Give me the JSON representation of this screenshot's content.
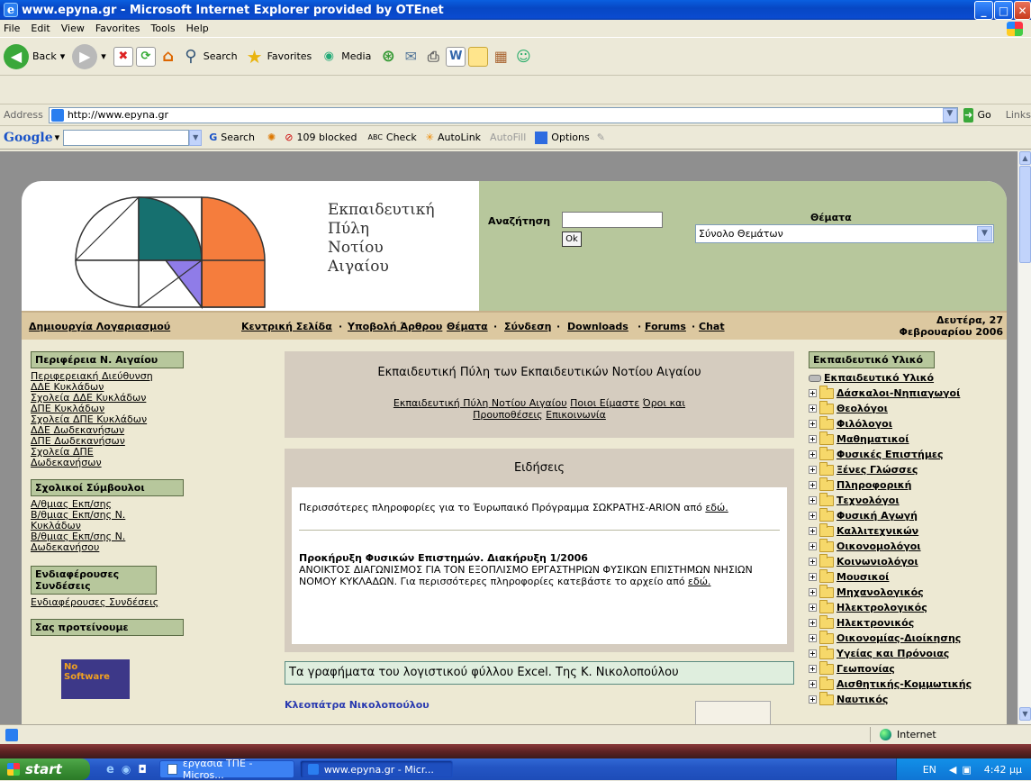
{
  "window": {
    "title": "www.epyna.gr - Microsoft Internet Explorer provided by OTEnet"
  },
  "menu": [
    "File",
    "Edit",
    "View",
    "Favorites",
    "Tools",
    "Help"
  ],
  "toolbar": {
    "back": "Back",
    "search": "Search",
    "favorites": "Favorites",
    "media": "Media"
  },
  "address": {
    "label": "Address",
    "url": "http://www.epyna.gr",
    "go": "Go",
    "links": "Links"
  },
  "google": {
    "logo": "Google",
    "search": "Search",
    "blocked": "109 blocked",
    "check": "Check",
    "autolink": "AutoLink",
    "autofill": "AutoFill",
    "options": "Options"
  },
  "site": {
    "logo_text": [
      "Εκπαιδευτική",
      "Πύλη",
      "Νοτίου",
      "Αιγαίου"
    ],
    "search_label": "Αναζήτηση",
    "search_button": "Ok",
    "themes_label": "Θέματα",
    "themes_selected": "Σύνολο Θεμάτων",
    "nav": {
      "create_account": "Δημιουργία Λογαριασμού",
      "home": "Κεντρική Σελίδα",
      "submit": "Υποβολή Άρθρου",
      "themes": "Θέματα",
      "login": "Σύνδεση",
      "downloads": "Downloads",
      "forums": "Forums",
      "chat": "Chat",
      "date_line1": "Δευτέρα, 27",
      "date_line2": "Φεβρουαρίου 2006"
    },
    "left": {
      "region_title": "Περιφέρεια Ν. Αιγαίου",
      "region_links": [
        "Περιφερειακή Διεύθυνση",
        "ΔΔΕ Κυκλάδων",
        "Σχολεία ΔΔΕ Κυκλάδων",
        "ΔΠΕ Κυκλάδων",
        "Σχολεία ΔΠΕ Κυκλάδων",
        "ΔΔΕ Δωδεκανήσων",
        "ΔΠΕ Δωδεκανήσων",
        "Σχολεία ΔΠΕ",
        "Δωδεκανήσων"
      ],
      "advisors_title": "Σχολικοί Σύμβουλοι",
      "advisors_links": [
        "Α/θμιας Εκπ/σης",
        "Β/θμιας Εκπ/σης Ν.",
        "Κυκλάδων",
        "Β/θμιας Εκπ/σης Ν.",
        "Δωδεκανήσου"
      ],
      "interesting_title": "Ενδιαφέρουσες Συνδέσεις",
      "interesting_link": "Ενδιαφέρουσες Συνδέσεις",
      "suggest_title": "Σας προτείνουμε",
      "banner_text": [
        "No",
        "Software"
      ]
    },
    "center": {
      "portal_title": "Εκπαιδευτική Πύλη των Εκπαιδευτικών Νοτίου Αιγαίου",
      "portal_link1": "Εκπαιδευτική Πύλη Νοτίου Αιγαίου",
      "portal_link2": "Ποιοι Είμαστε",
      "portal_link3": "Όροι και",
      "portal_link3b": "Προυποθέσεις",
      "portal_link4": "Επικοινωνία",
      "news_title": "Ειδήσεις",
      "news1_text": "Περισσότερες πληροφορίες για το Έυρωπαικό Πρόγραμμα ΣΩΚΡΑΤΗΣ-ARION από",
      "news1_link": "εδώ.",
      "news2_title": "Προκήρυξη Φυσικών Επιστημών. Διακήρυξη 1/2006",
      "news2_text": "ΑΝΟΙΚΤΟΣ ΔΙΑΓΩΝΙΣΜΟΣ ΓΙΑ ΤΟΝ ΕΞΟΠΛΙΣΜΟ ΕΡΓΑΣΤΗΡΙΩΝ ΦΥΣΙΚΩΝ ΕΠΙΣΤΗΜΩΝ ΝΗΣΙΩΝ ΝΟΜΟΥ ΚΥΚΛΑΔΩΝ. Για περισσότερες πληροφορίες κατεβάστε το αρχείο από",
      "news2_link": "εδώ.",
      "article_title": "Τα γραφήματα του λογιστικού φύλλου Excel. Της Κ. Νικολοπούλου",
      "author": "Κλεοπάτρα Νικολοπούλου"
    },
    "right": {
      "title": "Εκπαιδευτικό Υλικό",
      "root": "Εκπαιδευτικό Υλικό",
      "items": [
        "Δάσκαλοι-Νηπιαγωγοί",
        "Θεολόγοι",
        "Φιλόλογοι",
        "Μαθηματικοί",
        "Φυσικές Επιστήμες",
        "Ξένες Γλώσσες",
        "Πληροφορική",
        "Τεχνολόγοι",
        "Φυσική Αγωγή",
        "Καλλιτεχνικών",
        "Οικονομολόγοι",
        "Κοινωνιολόγοι",
        "Μουσικοί",
        "Μηχανολογικός",
        "Ηλεκτρολογικός",
        "Ηλεκτρονικός",
        "Οικονομίας-Διοίκησης",
        "Υγείας και Πρόνοιας",
        "Γεωπονίας",
        "Αισθητικής-Κομμωτικής",
        "Ναυτικός"
      ]
    }
  },
  "status": {
    "zone": "Internet"
  },
  "taskbar": {
    "start": "start",
    "task1": "εργασια ΤΠΕ - Micros...",
    "task2": "www.epyna.gr - Micr...",
    "lang": "EN",
    "clock": "4:42 μμ"
  },
  "colors": {
    "header_green": "#b7c79c",
    "nav_tan": "#dcc8a0",
    "logo_teal": "#16706f",
    "logo_purple": "#8f7ce8",
    "logo_orange": "#f57d3d"
  }
}
